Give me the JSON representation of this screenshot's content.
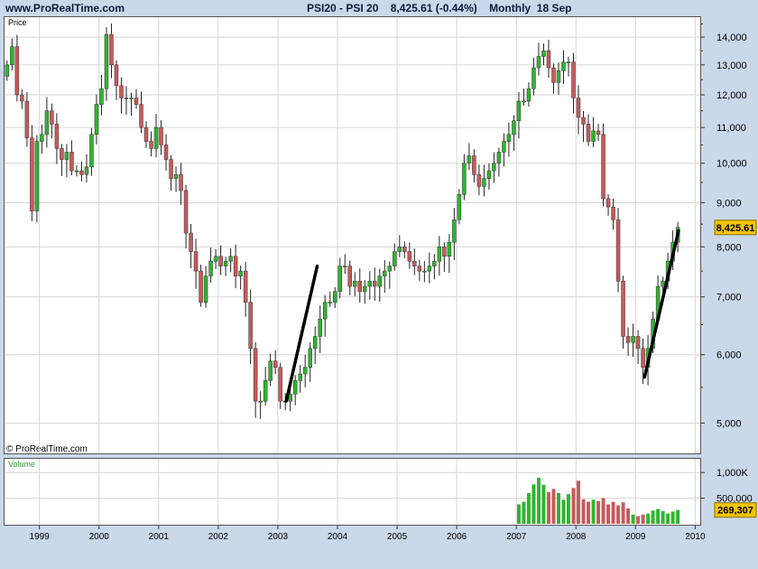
{
  "header": {
    "site": "www.ProRealTime.com",
    "title": "PSI20 - PSI 20    8,425.61 (-0.44%)    Monthly  18 Sep"
  },
  "price_panel": {
    "label": "Price",
    "copyright": "© ProRealTime.com"
  },
  "volume_panel": {
    "label": "Volume"
  },
  "colors": {
    "up": "#2fb52f",
    "down": "#c85a5a",
    "grid": "#d6d6d6",
    "background": "#ffffff",
    "frame": "#c9d9ea",
    "last_badge": "#f5c400",
    "trendline": "#000000"
  },
  "chart_data": [
    {
      "type": "candlestick",
      "title": "PSI20 - PSI 20",
      "ylabel": "Price",
      "y_scale": "log",
      "ylim": [
        4600,
        14800
      ],
      "y_ticks": [
        5000,
        6000,
        7000,
        8000,
        9000,
        10000,
        11000,
        12000,
        13000,
        14000
      ],
      "y_tick_labels": [
        "5,000",
        "6,000",
        "7,000",
        "8,000",
        "9,000",
        "10,000",
        "11,000",
        "12,000",
        "13,000",
        "14,000"
      ],
      "x_ticks": [
        1999,
        2000,
        2001,
        2002,
        2003,
        2004,
        2005,
        2006,
        2007,
        2008,
        2009,
        2010
      ],
      "x_tick_labels": [
        "1999",
        "2000",
        "2001",
        "2002",
        "2003",
        "2004",
        "2005",
        "2006",
        "2007",
        "2008",
        "2009",
        "2010"
      ],
      "x_range": [
        1998.4,
        2010.1
      ],
      "last_value": "8,425.61",
      "grid": true,
      "close_series": [
        [
          "1998-06",
          13000
        ],
        [
          "1998-07",
          13650
        ],
        [
          "1998-08",
          12000
        ],
        [
          "1998-09",
          11800
        ],
        [
          "1998-10",
          10700
        ],
        [
          "1998-11",
          8800
        ],
        [
          "1998-12",
          10600
        ],
        [
          "1999-01",
          10800
        ],
        [
          "1999-02",
          11500
        ],
        [
          "1999-03",
          11100
        ],
        [
          "1999-04",
          10400
        ],
        [
          "1999-05",
          10100
        ],
        [
          "1999-06",
          10300
        ],
        [
          "1999-07",
          9800
        ],
        [
          "1999-08",
          9800
        ],
        [
          "1999-09",
          9700
        ],
        [
          "1999-10",
          9900
        ],
        [
          "1999-11",
          10800
        ],
        [
          "1999-12",
          11700
        ],
        [
          "2000-01",
          12200
        ],
        [
          "2000-02",
          14100
        ],
        [
          "2000-03",
          13000
        ],
        [
          "2000-04",
          12300
        ],
        [
          "2000-05",
          11900
        ],
        [
          "2000-06",
          11900
        ],
        [
          "2000-07",
          11900
        ],
        [
          "2000-08",
          11700
        ],
        [
          "2000-09",
          11000
        ],
        [
          "2000-10",
          10600
        ],
        [
          "2000-11",
          10400
        ],
        [
          "2000-12",
          11000
        ],
        [
          "2001-01",
          10500
        ],
        [
          "2001-02",
          10100
        ],
        [
          "2001-03",
          9600
        ],
        [
          "2001-04",
          9700
        ],
        [
          "2001-05",
          9300
        ],
        [
          "2001-06",
          8300
        ],
        [
          "2001-07",
          7900
        ],
        [
          "2001-08",
          7500
        ],
        [
          "2001-09",
          6900
        ],
        [
          "2001-10",
          7400
        ],
        [
          "2001-11",
          7700
        ],
        [
          "2001-12",
          7800
        ],
        [
          "2002-01",
          7600
        ],
        [
          "2002-02",
          7700
        ],
        [
          "2002-03",
          7800
        ],
        [
          "2002-04",
          7400
        ],
        [
          "2002-05",
          7500
        ],
        [
          "2002-06",
          6900
        ],
        [
          "2002-07",
          6100
        ],
        [
          "2002-08",
          5300
        ],
        [
          "2002-09",
          5300
        ],
        [
          "2002-10",
          5600
        ],
        [
          "2002-11",
          5900
        ],
        [
          "2002-12",
          5800
        ],
        [
          "2003-01",
          5300
        ],
        [
          "2003-02",
          5300
        ],
        [
          "2003-03",
          5400
        ],
        [
          "2003-04",
          5600
        ],
        [
          "2003-05",
          5700
        ],
        [
          "2003-06",
          5800
        ],
        [
          "2003-07",
          6100
        ],
        [
          "2003-08",
          6300
        ],
        [
          "2003-09",
          6600
        ],
        [
          "2003-10",
          6900
        ],
        [
          "2003-11",
          6900
        ],
        [
          "2003-12",
          7100
        ],
        [
          "2004-01",
          7600
        ],
        [
          "2004-02",
          7600
        ],
        [
          "2004-03",
          7200
        ],
        [
          "2004-04",
          7300
        ],
        [
          "2004-05",
          7100
        ],
        [
          "2004-06",
          7200
        ],
        [
          "2004-07",
          7300
        ],
        [
          "2004-08",
          7200
        ],
        [
          "2004-09",
          7400
        ],
        [
          "2004-10",
          7500
        ],
        [
          "2004-11",
          7600
        ],
        [
          "2004-12",
          7900
        ],
        [
          "2005-01",
          8000
        ],
        [
          "2005-02",
          7900
        ],
        [
          "2005-03",
          7700
        ],
        [
          "2005-04",
          7600
        ],
        [
          "2005-05",
          7500
        ],
        [
          "2005-06",
          7500
        ],
        [
          "2005-07",
          7600
        ],
        [
          "2005-08",
          7700
        ],
        [
          "2005-09",
          8000
        ],
        [
          "2005-10",
          7800
        ],
        [
          "2005-11",
          8100
        ],
        [
          "2005-12",
          8600
        ],
        [
          "2006-01",
          9200
        ],
        [
          "2006-02",
          10000
        ],
        [
          "2006-03",
          10200
        ],
        [
          "2006-04",
          9700
        ],
        [
          "2006-05",
          9400
        ],
        [
          "2006-06",
          9600
        ],
        [
          "2006-07",
          9800
        ],
        [
          "2006-08",
          10000
        ],
        [
          "2006-09",
          10300
        ],
        [
          "2006-10",
          10600
        ],
        [
          "2006-11",
          10800
        ],
        [
          "2006-12",
          11200
        ],
        [
          "2007-01",
          11800
        ],
        [
          "2007-02",
          11800
        ],
        [
          "2007-03",
          12200
        ],
        [
          "2007-04",
          12900
        ],
        [
          "2007-05",
          13300
        ],
        [
          "2007-06",
          13500
        ],
        [
          "2007-07",
          12900
        ],
        [
          "2007-08",
          12400
        ],
        [
          "2007-09",
          12800
        ],
        [
          "2007-10",
          13100
        ],
        [
          "2007-11",
          13100
        ],
        [
          "2007-12",
          11900
        ],
        [
          "2008-01",
          11300
        ],
        [
          "2008-02",
          11100
        ],
        [
          "2008-03",
          10600
        ],
        [
          "2008-04",
          10900
        ],
        [
          "2008-05",
          10800
        ],
        [
          "2008-06",
          9100
        ],
        [
          "2008-07",
          8900
        ],
        [
          "2008-08",
          8600
        ],
        [
          "2008-09",
          7300
        ],
        [
          "2008-10",
          6300
        ],
        [
          "2008-11",
          6200
        ],
        [
          "2008-12",
          6300
        ],
        [
          "2009-01",
          6100
        ],
        [
          "2009-02",
          5800
        ],
        [
          "2009-03",
          6100
        ],
        [
          "2009-04",
          6600
        ],
        [
          "2009-05",
          7200
        ],
        [
          "2009-06",
          7300
        ],
        [
          "2009-07",
          7700
        ],
        [
          "2009-08",
          8100
        ],
        [
          "2009-09",
          8425.61
        ]
      ]
    },
    {
      "type": "bar",
      "ylabel": "Volume",
      "y_ticks": [
        500000,
        1000000
      ],
      "y_tick_labels": [
        "500,000",
        "1,000K"
      ],
      "last_value": "269,307",
      "series": [
        {
          "values": [
            [
              "2007-01",
              380000
            ],
            [
              "2007-02",
              430000
            ],
            [
              "2007-03",
              600000
            ],
            [
              "2007-04",
              770000
            ],
            [
              "2007-05",
              900000
            ],
            [
              "2007-06",
              760000
            ],
            [
              "2007-07",
              620000
            ],
            [
              "2007-08",
              680000
            ],
            [
              "2007-09",
              600000
            ],
            [
              "2007-10",
              470000
            ],
            [
              "2007-11",
              580000
            ],
            [
              "2007-12",
              700000
            ],
            [
              "2008-01",
              840000
            ],
            [
              "2008-02",
              480000
            ],
            [
              "2008-03",
              430000
            ],
            [
              "2008-04",
              470000
            ],
            [
              "2008-05",
              440000
            ],
            [
              "2008-06",
              500000
            ],
            [
              "2008-07",
              380000
            ],
            [
              "2008-08",
              430000
            ],
            [
              "2008-09",
              360000
            ],
            [
              "2008-10",
              420000
            ],
            [
              "2008-11",
              300000
            ],
            [
              "2008-12",
              180000
            ],
            [
              "2009-01",
              150000
            ],
            [
              "2009-02",
              180000
            ],
            [
              "2009-03",
              200000
            ],
            [
              "2009-04",
              260000
            ],
            [
              "2009-05",
              290000
            ],
            [
              "2009-06",
              250000
            ],
            [
              "2009-07",
              200000
            ],
            [
              "2009-08",
              240000
            ],
            [
              "2009-09",
              269307
            ]
          ]
        }
      ]
    }
  ]
}
